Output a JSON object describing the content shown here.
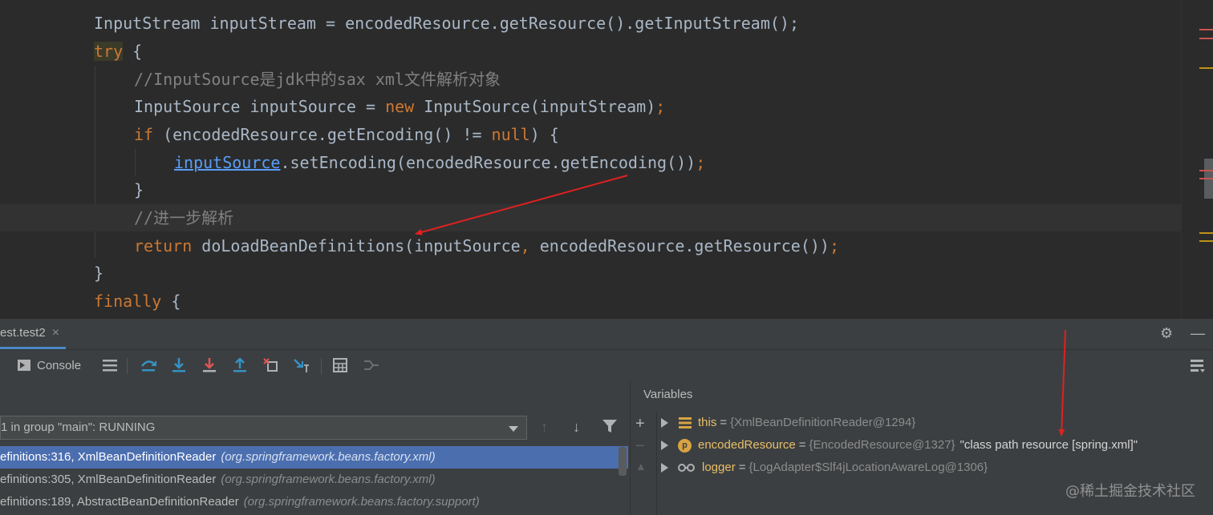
{
  "editor": {
    "lines": [
      {
        "segments": [
          {
            "t": "InputStream inputStream = encodedResource.getResource().getInputStream();",
            "c": ""
          }
        ]
      },
      {
        "segments": [
          {
            "t": "try",
            "c": "kw try-hl"
          },
          {
            "t": " {",
            "c": ""
          }
        ]
      },
      {
        "segments": [
          {
            "t": "//InputSource是jdk中的sax xml文件解析对象",
            "c": "cm"
          }
        ]
      },
      {
        "segments": [
          {
            "t": "InputSource inputSource = ",
            "c": ""
          },
          {
            "t": "new",
            "c": "kw"
          },
          {
            "t": " InputSource(inputStream)",
            "c": ""
          },
          {
            "t": ";",
            "c": "kw"
          }
        ]
      },
      {
        "segments": [
          {
            "t": "if",
            "c": "kw"
          },
          {
            "t": " (encodedResource.getEncoding() != ",
            "c": ""
          },
          {
            "t": "null",
            "c": "kw"
          },
          {
            "t": ") {",
            "c": ""
          }
        ]
      },
      {
        "segments": [
          {
            "t": "inputSource",
            "c": "lnk"
          },
          {
            "t": ".setEncoding(encodedResource.getEncoding())",
            "c": ""
          },
          {
            "t": ";",
            "c": "kw"
          }
        ]
      },
      {
        "segments": [
          {
            "t": "}",
            "c": ""
          }
        ]
      },
      {
        "segments": [
          {
            "t": "//进一步解析",
            "c": "cm"
          }
        ]
      },
      {
        "segments": [
          {
            "t": "return",
            "c": "kw"
          },
          {
            "t": " doLoadBeanDefinitions(inputSource",
            "c": ""
          },
          {
            "t": ",",
            "c": "kw"
          },
          {
            "t": " encodedResource.getResource())",
            "c": ""
          },
          {
            "t": ";",
            "c": "kw"
          }
        ]
      },
      {
        "segments": [
          {
            "t": "}",
            "c": ""
          }
        ]
      },
      {
        "segments": [
          {
            "t": "finally",
            "c": "kw"
          },
          {
            "t": " {",
            "c": ""
          }
        ]
      }
    ],
    "error_badge": "!"
  },
  "debug": {
    "session_tab": "est.test2",
    "close_glyph": "×",
    "settings_glyph": "⚙",
    "minimize_glyph": "—",
    "console_label": "Console",
    "thread_value": "1 in group \"main\": RUNNING",
    "frames": [
      {
        "method": "efinitions:316, XmlBeanDefinitionReader",
        "pkg": "(org.springframework.beans.factory.xml)"
      },
      {
        "method": "efinitions:305, XmlBeanDefinitionReader",
        "pkg": "(org.springframework.beans.factory.xml)"
      },
      {
        "method": "efinitions:189, AbstractBeanDefinitionReader",
        "pkg": "(org.springframework.beans.factory.support)"
      }
    ],
    "variables_title": "Variables",
    "variables": [
      {
        "icon": "field-list-icon",
        "name": "this",
        "value": "{XmlBeanDefinitionReader@1294}",
        "extra": ""
      },
      {
        "icon": "parameter-icon",
        "name": "encodedResource",
        "value": "{EncodedResource@1327}",
        "extra": "\"class path resource [spring.xml]\""
      },
      {
        "icon": "watch-glasses-icon",
        "name": "logger",
        "value": "{LogAdapter$Slf4jLocationAwareLog@1306}",
        "extra": ""
      }
    ],
    "param_badge": "p"
  },
  "watermark": "@稀土掘金技术社区",
  "colors": {
    "editor_bg": "#2b2b2b",
    "keyword": "#cc7832",
    "comment": "#808080",
    "text": "#a9b7c6",
    "selection": "#4b6eaf",
    "arrow": "#e02020"
  }
}
